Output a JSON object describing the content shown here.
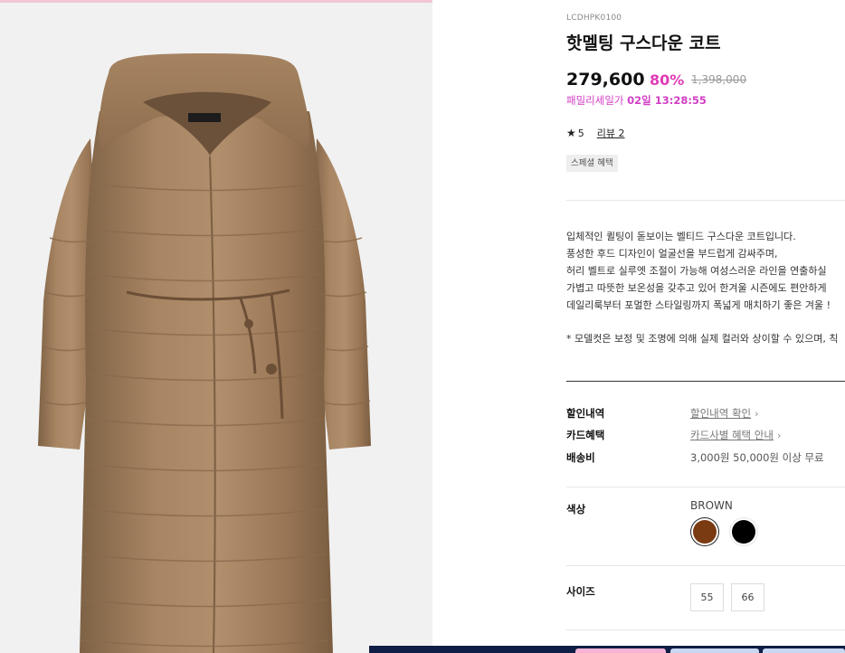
{
  "product": {
    "code": "LCDHPK0100",
    "title": "핫멜팅 구스다운 코트",
    "price": "279,600",
    "discount": "80%",
    "original_price": "1,398,000",
    "sale_label": "패밀리세일가",
    "sale_countdown": "02일 13:28:55",
    "rating_star": "★",
    "rating_value": "5",
    "review_link": "리뷰 2",
    "badge": "스페셜 혜택",
    "image_alt": "brown goose down hooded long coat"
  },
  "description": {
    "lines": [
      "입체적인 퀼팅이 돋보이는 벨티드 구스다운 코트입니다.",
      "풍성한 후드 디자인이 얼굴선을 부드럽게 감싸주며,",
      "허리 벨트로 실루엣 조절이 가능해 여성스러운 라인을 연출하실",
      "가볍고 따뜻한 보온성을 갖추고 있어 한겨울 시즌에도 편안하게",
      "데일리룩부터 포멀한 스타일링까지 폭넓게 매치하기 좋은 겨울 !"
    ],
    "note": "* 모델컷은 보정 및 조명에 의해 실제 컬러와 상이할 수 있으며, 칙"
  },
  "info_rows": {
    "discount_label": "할인내역",
    "discount_value": "할인내역 확인",
    "card_label": "카드혜택",
    "card_value": "카드사별 혜택 안내",
    "shipping_label": "배송비",
    "shipping_value": "3,000원 50,000원 이상 무료"
  },
  "options": {
    "color_label": "색상",
    "selected_color": "BROWN",
    "colors": [
      "#7a3a12",
      "#000000"
    ],
    "size_label": "사이즈",
    "sizes": [
      "55",
      "66"
    ]
  },
  "icons": {
    "chevron": "›"
  }
}
